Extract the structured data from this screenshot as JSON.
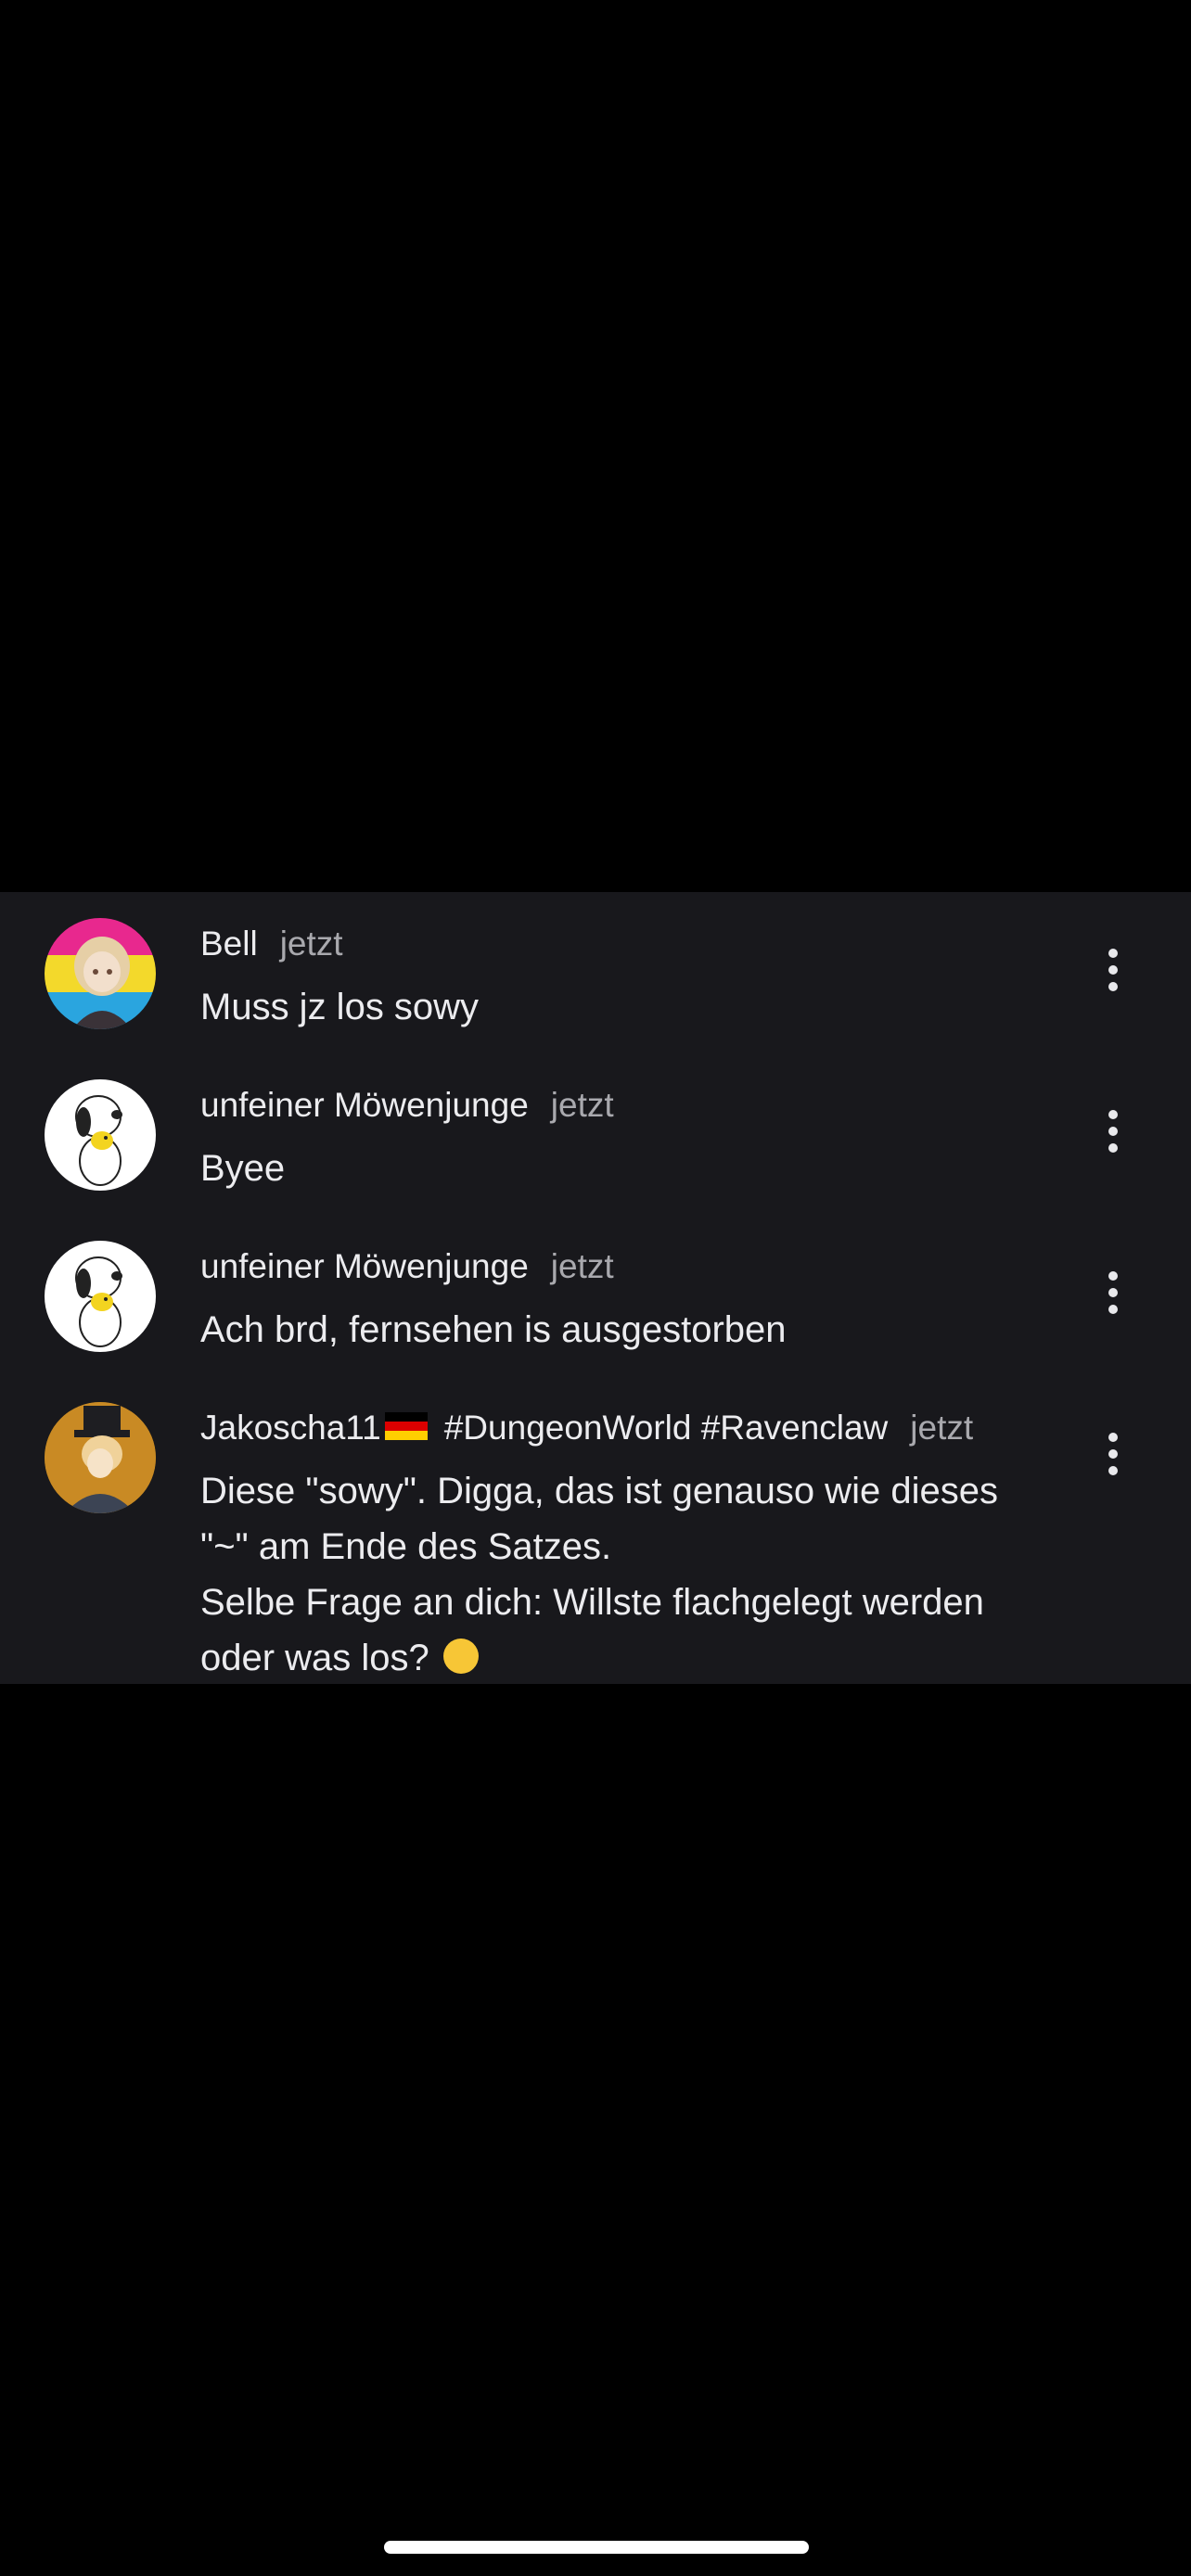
{
  "comments": [
    {
      "author": "Bell",
      "time": "jetzt",
      "lines": [
        "Muss jz los sowy"
      ],
      "avatar_icon": "pride-flag-anime-avatar"
    },
    {
      "author": "unfeiner Möwenjunge",
      "time": "jetzt",
      "lines": [
        "Byee"
      ],
      "avatar_icon": "snoopy-woodstock-avatar"
    },
    {
      "author": "unfeiner Möwenjunge",
      "time": "jetzt",
      "lines": [
        "Ach brd, fernsehen is ausgestorben"
      ],
      "avatar_icon": "snoopy-woodstock-avatar"
    },
    {
      "author": "Jakoscha11",
      "author_suffix": "#DungeonWorld #Ravenclaw",
      "flag_icon": "germany-flag-icon",
      "time": "jetzt",
      "lines": [
        "Diese \"sowy\". Digga, das ist genauso wie dieses",
        "\"~\" am Ende des Satzes.",
        "Selbe Frage an dich: Willste flachgelegt werden",
        "oder was los?"
      ],
      "emoji": "smirking-face-emoji",
      "avatar_icon": "top-hat-character-avatar"
    }
  ],
  "colors": {
    "panel_background": "#18181c",
    "page_background": "#000000",
    "primary_text": "#ececef",
    "secondary_text": "#a9a9ae"
  }
}
